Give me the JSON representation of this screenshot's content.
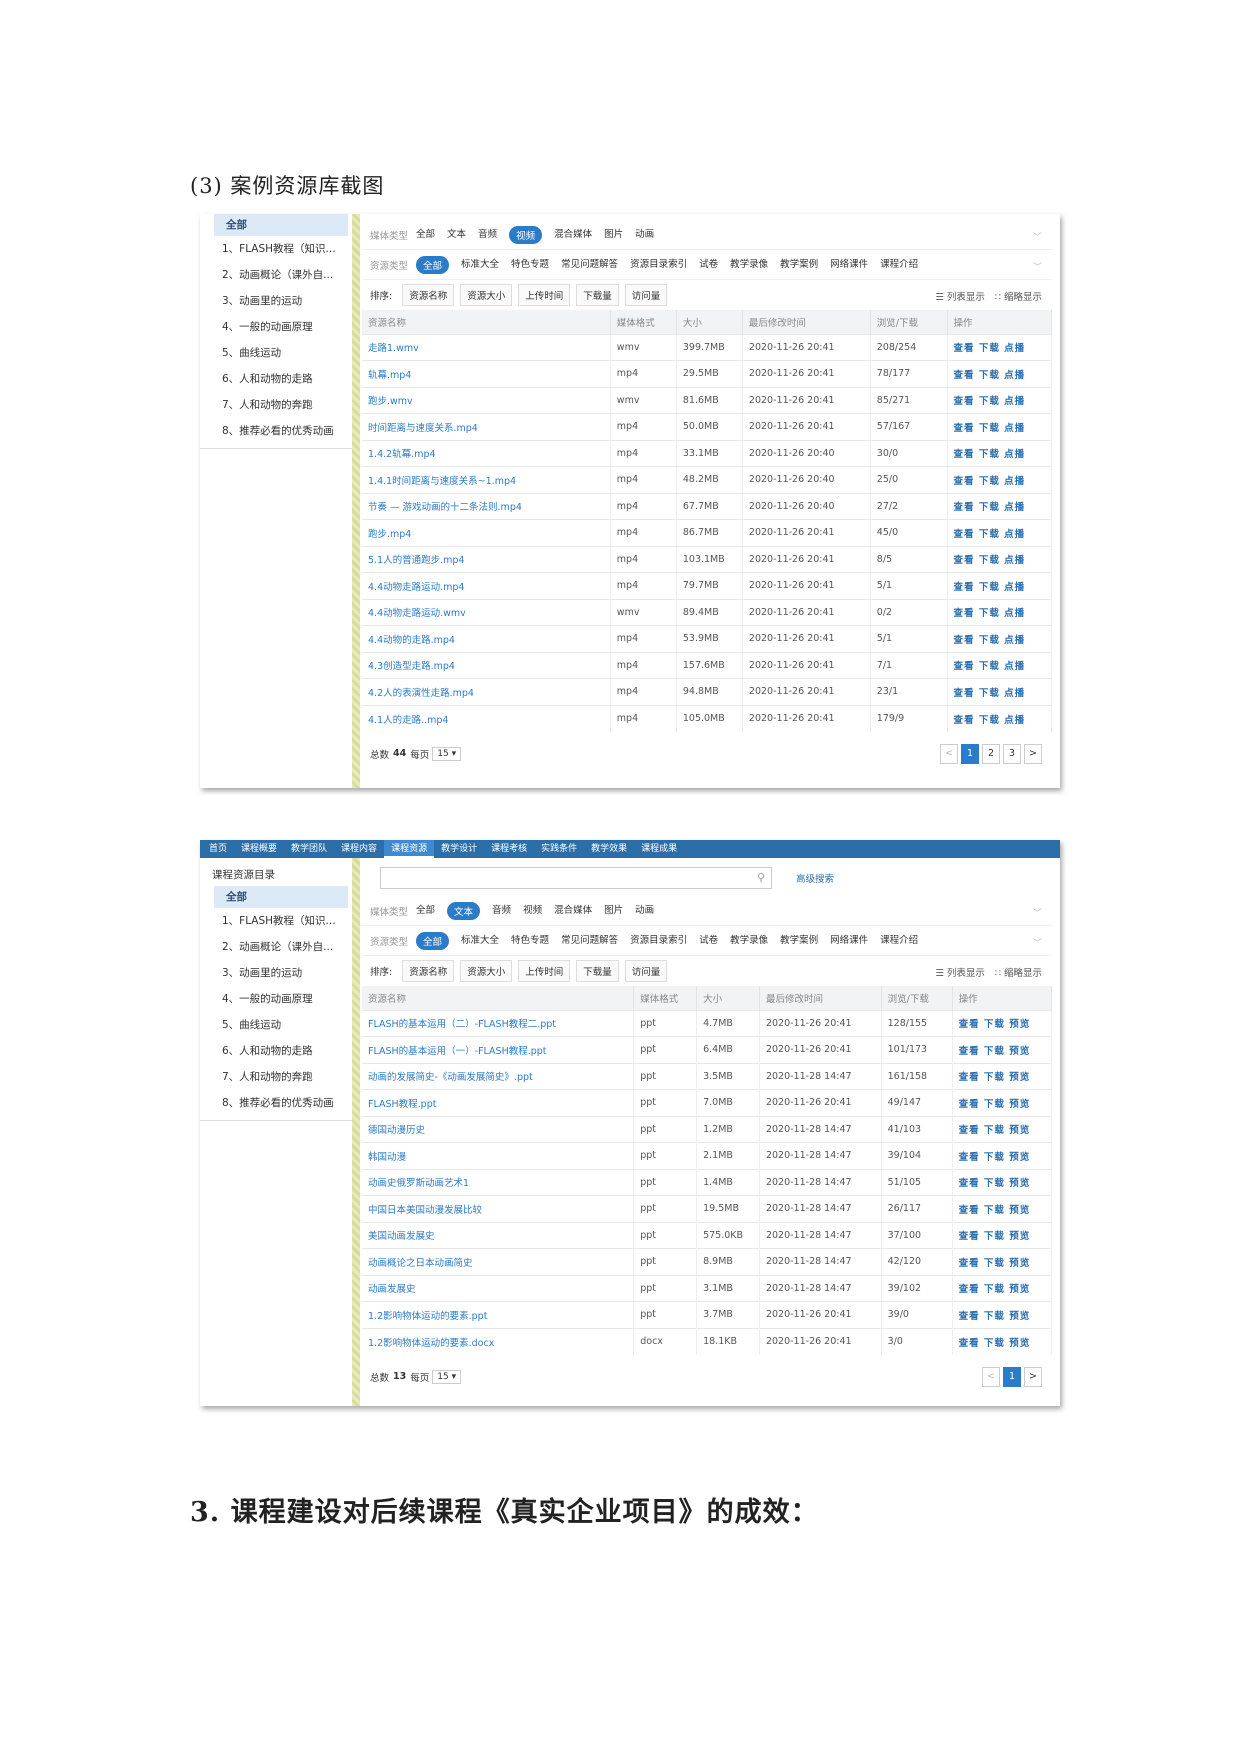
{
  "headings": {
    "caption": "(3) 案例资源库截图",
    "section": "3. 课程建设对后续课程《真实企业项目》的成效："
  },
  "common": {
    "media_type_label": "媒体类型",
    "media_types": [
      "全部",
      "文本",
      "音频",
      "视频",
      "混合媒体",
      "图片",
      "动画"
    ],
    "resource_type_label": "资源类型",
    "resource_types": [
      "全部",
      "标准大全",
      "特色专题",
      "常见问题解答",
      "资源目录索引",
      "试卷",
      "教学录像",
      "教学案例",
      "网络课件",
      "课程介绍"
    ],
    "sort_label": "排序:",
    "sort_buttons": [
      "资源名称",
      "资源大小",
      "上传时间",
      "下载量",
      "访问量"
    ],
    "view_list": "☰ 列表显示",
    "view_thumb": "∷ 缩略显示",
    "columns": [
      "资源名称",
      "媒体格式",
      "大小",
      "最后修改时间",
      "浏览/下载",
      "操作"
    ],
    "sidebar_all": "全部",
    "sidebar_items": [
      "1、FLASH教程（知识...",
      "2、动画概论（课外自...",
      "3、动画里的运动",
      "4、一般的动画原理",
      "5、曲线运动",
      "6、人和动物的走路",
      "7、人和动物的奔跑",
      "8、推荐必看的优秀动画"
    ],
    "per_page_label": "每页",
    "total_label": "总数",
    "prev": "<",
    "next": ">"
  },
  "shot1": {
    "active_media": "视频",
    "total": "44",
    "per_page": "15 ▾",
    "pages": [
      "1",
      "2",
      "3"
    ],
    "rows": [
      [
        "走路1.wmv",
        "wmv",
        "399.7MB",
        "2020-11-26 20:41",
        "208/254",
        "查看 下载 点播"
      ],
      [
        "轨幕.mp4",
        "mp4",
        "29.5MB",
        "2020-11-26 20:41",
        "78/177",
        "查看 下载 点播"
      ],
      [
        "跑步.wmv",
        "wmv",
        "81.6MB",
        "2020-11-26 20:41",
        "85/271",
        "查看 下载 点播"
      ],
      [
        "时间距离与速度关系.mp4",
        "mp4",
        "50.0MB",
        "2020-11-26 20:41",
        "57/167",
        "查看 下载 点播"
      ],
      [
        "1.4.2轨幕.mp4",
        "mp4",
        "33.1MB",
        "2020-11-26 20:40",
        "30/0",
        "查看 下载 点播"
      ],
      [
        "1.4.1时间距离与速度关系~1.mp4",
        "mp4",
        "48.2MB",
        "2020-11-26 20:40",
        "25/0",
        "查看 下载 点播"
      ],
      [
        "节奏 — 游戏动画的十二条法则.mp4",
        "mp4",
        "67.7MB",
        "2020-11-26 20:40",
        "27/2",
        "查看 下载 点播"
      ],
      [
        "跑步.mp4",
        "mp4",
        "86.7MB",
        "2020-11-26 20:41",
        "45/0",
        "查看 下载 点播"
      ],
      [
        "5.1人的普通跑步.mp4",
        "mp4",
        "103.1MB",
        "2020-11-26 20:41",
        "8/5",
        "查看 下载 点播"
      ],
      [
        "4.4动物走路运动.mp4",
        "mp4",
        "79.7MB",
        "2020-11-26 20:41",
        "5/1",
        "查看 下载 点播"
      ],
      [
        "4.4动物走路运动.wmv",
        "wmv",
        "89.4MB",
        "2020-11-26 20:41",
        "0/2",
        "查看 下载 点播"
      ],
      [
        " 4.4动物的走路.mp4",
        "mp4",
        "53.9MB",
        "2020-11-26 20:41",
        "5/1",
        "查看 下载 点播"
      ],
      [
        "4.3创造型走路.mp4",
        "mp4",
        "157.6MB",
        "2020-11-26 20:41",
        "7/1",
        "查看 下载 点播"
      ],
      [
        "4.2人的表演性走路.mp4",
        "mp4",
        "94.8MB",
        "2020-11-26 20:41",
        "23/1",
        "查看 下载 点播"
      ],
      [
        "4.1人的走路..mp4",
        "mp4",
        "105.0MB",
        "2020-11-26 20:41",
        "179/9",
        "查看 下载 点播"
      ]
    ]
  },
  "shot2": {
    "nav": [
      "首页",
      "课程概要",
      "教学团队",
      "课程内容",
      "课程资源",
      "教学设计",
      "课程考核",
      "实践条件",
      "教学效果",
      "课程成果"
    ],
    "active_nav": "课程资源",
    "sidebar_title": "课程资源目录",
    "search_icon": "⚲",
    "advanced_search": "高级搜索",
    "active_media": "文本",
    "total": "13",
    "per_page": "15 ▾",
    "pages": [
      "1"
    ],
    "rows": [
      [
        "FLASH的基本运用（二）-FLASH教程二.ppt",
        "ppt",
        "4.7MB",
        "2020-11-26 20:41",
        "128/155",
        "查看 下载 预览"
      ],
      [
        "FLASH的基本运用（一）-FLASH教程.ppt",
        "ppt",
        "6.4MB",
        "2020-11-26 20:41",
        "101/173",
        "查看 下载 预览"
      ],
      [
        "动画的发展简史-《动画发展简史》.ppt",
        "ppt",
        "3.5MB",
        "2020-11-28 14:47",
        "161/158",
        "查看 下载 预览"
      ],
      [
        "FLASH教程.ppt",
        "ppt",
        "7.0MB",
        "2020-11-26 20:41",
        "49/147",
        "查看 下载 预览"
      ],
      [
        "德国动漫历史",
        "ppt",
        "1.2MB",
        "2020-11-28 14:47",
        "41/103",
        "查看 下载 预览"
      ],
      [
        "韩国动漫",
        "ppt",
        "2.1MB",
        "2020-11-28 14:47",
        "39/104",
        "查看 下载 预览"
      ],
      [
        "动画史俄罗斯动画艺术1",
        "ppt",
        "1.4MB",
        "2020-11-28 14:47",
        "51/105",
        "查看 下载 预览"
      ],
      [
        "中国日本美国动漫发展比较",
        "ppt",
        "19.5MB",
        "2020-11-28 14:47",
        "26/117",
        "查看 下载 预览"
      ],
      [
        "美国动画发展史",
        "ppt",
        "575.0KB",
        "2020-11-28 14:47",
        "37/100",
        "查看 下载 预览"
      ],
      [
        "动画概论之日本动画简史",
        "ppt",
        "8.9MB",
        "2020-11-28 14:47",
        "42/120",
        "查看 下载 预览"
      ],
      [
        "动画发展史",
        "ppt",
        "3.1MB",
        "2020-11-28 14:47",
        "39/102",
        "查看 下载 预览"
      ],
      [
        "1.2影响物体运动的要素.ppt",
        "ppt",
        "3.7MB",
        "2020-11-26 20:41",
        "39/0",
        "查看 下载 预览"
      ],
      [
        "1.2影响物体运动的要素.docx",
        "docx",
        "18.1KB",
        "2020-11-26 20:41",
        "3/0",
        "查看 下载 预览"
      ]
    ]
  }
}
